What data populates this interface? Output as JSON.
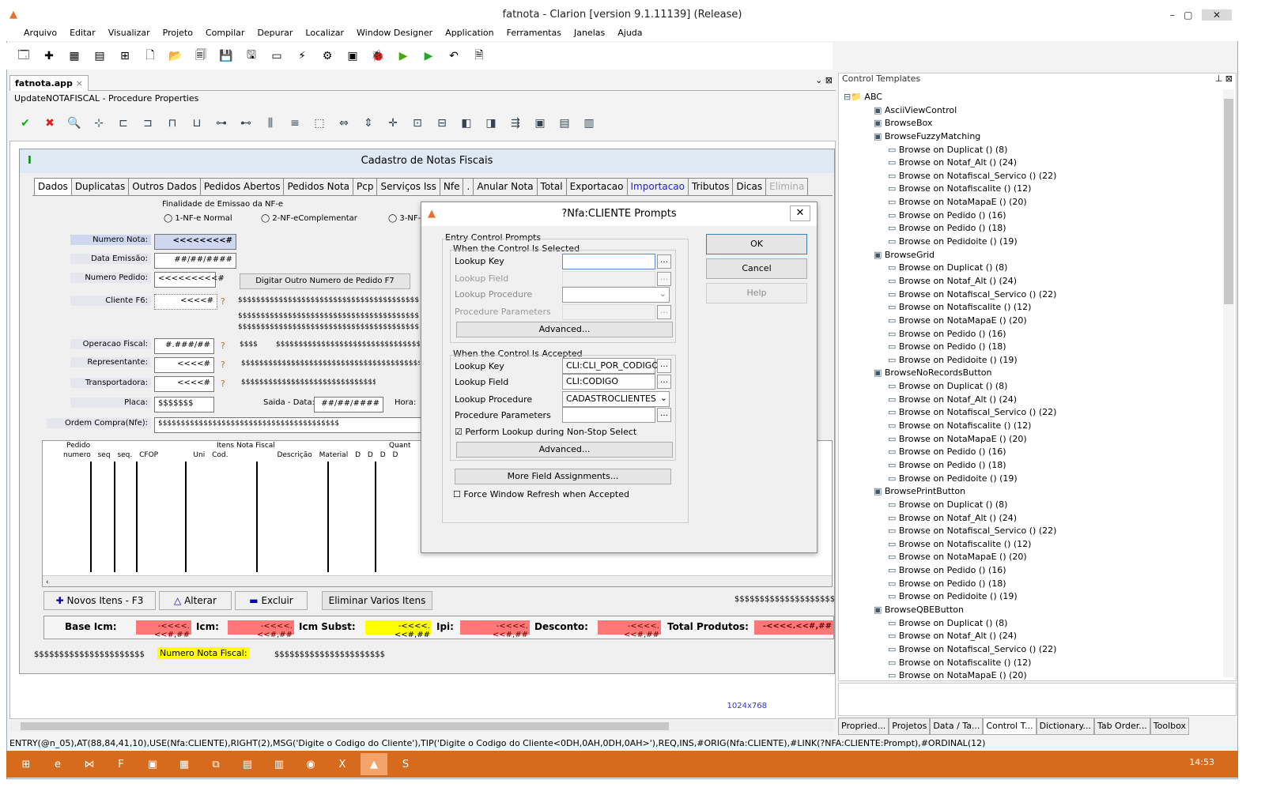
{
  "window": {
    "title": "fatnota - Clarion [version 9.1.11139] (Release)"
  },
  "menu": [
    "Arquivo",
    "Editar",
    "Visualizar",
    "Projeto",
    "Compilar",
    "Depurar",
    "Localizar",
    "Window Designer",
    "Application",
    "Ferramentas",
    "Janelas",
    "Ajuda"
  ],
  "doc": {
    "tab": "fatnota.app",
    "subtitle": "UpdateNOTAFISCAL - Procedure Properties",
    "size_tag": "1024x768"
  },
  "form": {
    "title": "Cadastro de Notas Fiscais",
    "tabs": [
      "Dados",
      "Duplicatas",
      "Outros Dados",
      "Pedidos Abertos",
      "Pedidos Nota",
      "Pcp",
      "Serviços Iss",
      "Nfe",
      ".",
      "Anular Nota",
      "Total",
      "Exportacao",
      "Importacao",
      "Tributos",
      "Dicas",
      "Elimina"
    ],
    "finalidade": "Finalidade de Emissao da NF-e",
    "radio1": "1-NF-e Normal",
    "radio2": "2-NF-eComplementar",
    "radio3": "3-NF-",
    "numero_nota": "Numero Nota:",
    "numero_nota_val": "<<<<<<<<#",
    "data_emissao": "Data Emissão:",
    "data_val": "##/##/####",
    "numero_pedido": "Numero Pedido:",
    "pedido_val": "<<<<<<<<<#",
    "btn_outro": "Digitar Outro Numero de Pedido F7",
    "cliente": "Cliente F6:",
    "cliente_val": "<<<<#",
    "operacao": "Operacao Fiscal:",
    "operacao_val": "#.###/##",
    "representante": "Representante:",
    "rep_val": "<<<<#",
    "transportadora": "Transportadora:",
    "transp_val": "<<<<#",
    "placa": "Placa:",
    "placa_val": "$$$$$$$",
    "saida": "Saida - Data:",
    "saida_val": "##/##/####",
    "hora": "Hora:",
    "ordem": "Ordem Compra(Nfe):",
    "dollars": "$$$$$$$$$$$$$$$$$$$$$$$$$$$$$$$$$$$$$$$$",
    "dollars_short": "$$$$",
    "grid_headers": [
      "Pedido",
      "Itens Nota Fiscal",
      "Quant"
    ],
    "grid_sub": [
      "numero",
      "seq",
      "seq.",
      "CFOP",
      "Uni",
      "Cod.",
      "Descrição Material",
      "D",
      "D",
      "D",
      "D"
    ],
    "btn_novos": "Novos Itens - F3",
    "btn_alterar": "Alterar",
    "btn_excluir": "Excluir",
    "btn_eliminar": "Eliminar Varios Itens",
    "base_icm": "Base Icm:",
    "icm": "Icm:",
    "icm_subst": "Icm Subst:",
    "ipi": "Ipi:",
    "desconto": "Desconto:",
    "total_produtos": "Total Produtos:",
    "money": "-<<<<.<<#,##",
    "money_total": "-<<<<.<<#,##",
    "footer_dollars": "$$$$$$$$$$$$$$$$$$$$$$",
    "numero_nota_fiscal": "Numero Nota Fiscal:"
  },
  "dialog": {
    "title": "?Nfa:CLIENTE Prompts",
    "entry": "Entry Control Prompts",
    "when_selected": "When the Control Is Selected",
    "lookup_key": "Lookup Key",
    "lookup_field": "Lookup Field",
    "lookup_procedure": "Lookup Procedure",
    "procedure_parameters": "Procedure Parameters",
    "advanced": "Advanced...",
    "when_accepted": "When the Control Is Accepted",
    "key_val": "CLI:CLI_POR_CODIGO",
    "field_val": "CLI:CODIGO",
    "proc_val": "CADASTROCLIENTES",
    "perform": "Perform Lookup during Non-Stop Select",
    "more": "More Field Assignments...",
    "force": "Force Window Refresh when Accepted",
    "ok": "OK",
    "cancel": "Cancel",
    "help": "Help"
  },
  "panel": {
    "title": "Control Templates",
    "tree": [
      {
        "t": "ABC",
        "l": 0
      },
      {
        "t": "AsciiViewControl",
        "l": 1
      },
      {
        "t": "BrowseBox",
        "l": 1
      },
      {
        "t": "BrowseFuzzyMatching",
        "l": 1
      },
      {
        "t": "Browse on Duplicat () (8)",
        "l": 2
      },
      {
        "t": "Browse on Notaf_Alt () (24)",
        "l": 2
      },
      {
        "t": "Browse on Notafiscal_Servico () (22)",
        "l": 2
      },
      {
        "t": "Browse on Notafiscalite () (12)",
        "l": 2
      },
      {
        "t": "Browse on NotaMapaE () (20)",
        "l": 2
      },
      {
        "t": "Browse on Pedido () (16)",
        "l": 2
      },
      {
        "t": "Browse on Pedido () (18)",
        "l": 2
      },
      {
        "t": "Browse on Pedidoite () (19)",
        "l": 2
      },
      {
        "t": "BrowseGrid",
        "l": 1
      },
      {
        "t": "Browse on Duplicat () (8)",
        "l": 2
      },
      {
        "t": "Browse on Notaf_Alt () (24)",
        "l": 2
      },
      {
        "t": "Browse on Notafiscal_Servico () (22)",
        "l": 2
      },
      {
        "t": "Browse on Notafiscalite () (12)",
        "l": 2
      },
      {
        "t": "Browse on NotaMapaE () (20)",
        "l": 2
      },
      {
        "t": "Browse on Pedido () (16)",
        "l": 2
      },
      {
        "t": "Browse on Pedido () (18)",
        "l": 2
      },
      {
        "t": "Browse on Pedidoite () (19)",
        "l": 2
      },
      {
        "t": "BrowseNoRecordsButton",
        "l": 1
      },
      {
        "t": "Browse on Duplicat () (8)",
        "l": 2
      },
      {
        "t": "Browse on Notaf_Alt () (24)",
        "l": 2
      },
      {
        "t": "Browse on Notafiscal_Servico () (22)",
        "l": 2
      },
      {
        "t": "Browse on Notafiscalite () (12)",
        "l": 2
      },
      {
        "t": "Browse on NotaMapaE () (20)",
        "l": 2
      },
      {
        "t": "Browse on Pedido () (16)",
        "l": 2
      },
      {
        "t": "Browse on Pedido () (18)",
        "l": 2
      },
      {
        "t": "Browse on Pedidoite () (19)",
        "l": 2
      },
      {
        "t": "BrowsePrintButton",
        "l": 1
      },
      {
        "t": "Browse on Duplicat () (8)",
        "l": 2
      },
      {
        "t": "Browse on Notaf_Alt () (24)",
        "l": 2
      },
      {
        "t": "Browse on Notafiscal_Servico () (22)",
        "l": 2
      },
      {
        "t": "Browse on Notafiscalite () (12)",
        "l": 2
      },
      {
        "t": "Browse on NotaMapaE () (20)",
        "l": 2
      },
      {
        "t": "Browse on Pedido () (16)",
        "l": 2
      },
      {
        "t": "Browse on Pedido () (18)",
        "l": 2
      },
      {
        "t": "Browse on Pedidoite () (19)",
        "l": 2
      },
      {
        "t": "BrowseQBEButton",
        "l": 1
      },
      {
        "t": "Browse on Duplicat () (8)",
        "l": 2
      },
      {
        "t": "Browse on Notaf_Alt () (24)",
        "l": 2
      },
      {
        "t": "Browse on Notafiscal_Servico () (22)",
        "l": 2
      },
      {
        "t": "Browse on Notafiscalite () (12)",
        "l": 2
      },
      {
        "t": "Browse on NotaMapaE () (20)",
        "l": 2
      }
    ],
    "bottom_tabs": [
      "Propried...",
      "Projetos",
      "Data / Ta...",
      "Control T...",
      "Dictionary...",
      "Tab Order...",
      "Toolbox"
    ]
  },
  "status": "ENTRY(@n_05),AT(88,84,41,10),USE(Nfa:CLIENTE),RIGHT(2),MSG('Digite o Codigo do Cliente'),TIP('Digite o Codigo do Cliente<0DH,0AH,0DH,0AH>'),REQ,INS,#ORIG(Nfa:CLIENTE),#LINK(?NFA:CLIENTE:Prompt),#ORDINAL(12)",
  "clock": "14:53"
}
